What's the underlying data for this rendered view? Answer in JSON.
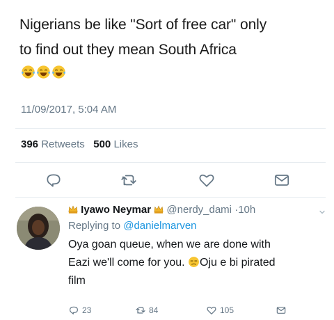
{
  "tweet": {
    "line1": "Nigerians be like \"Sort of free car\" only",
    "line2": "to find out they mean South Africa",
    "emoji": [
      "face-with-tears-of-joy",
      "face-with-tears-of-joy",
      "face-with-tears-of-joy"
    ],
    "timestamp": "11/09/2017, 5:04 AM"
  },
  "stats": {
    "retweets_count": "396",
    "retweets_label": "Retweets",
    "likes_count": "500",
    "likes_label": "Likes"
  },
  "actions": [
    "reply-icon",
    "retweet-icon",
    "like-icon",
    "direct-message-icon"
  ],
  "reply": {
    "display_name": "Iyawo Neymar",
    "handle": "@nerdy_dami",
    "separator": "·",
    "time": "10h",
    "replying_prefix": "Replying to",
    "replying_to": "@danielmarven",
    "body_line1": "Oya goan queue, when we are done with",
    "body_line2a": "Eazi we'll come for you.",
    "body_line2b": "Oju e bi pirated",
    "body_line3": "film",
    "reply_count": "23",
    "retweet_count": "84",
    "like_count": "105"
  },
  "colors": {
    "text": "#14171a",
    "secondary": "#657786",
    "link": "#1b95e0",
    "divider": "#e6ecf0"
  }
}
